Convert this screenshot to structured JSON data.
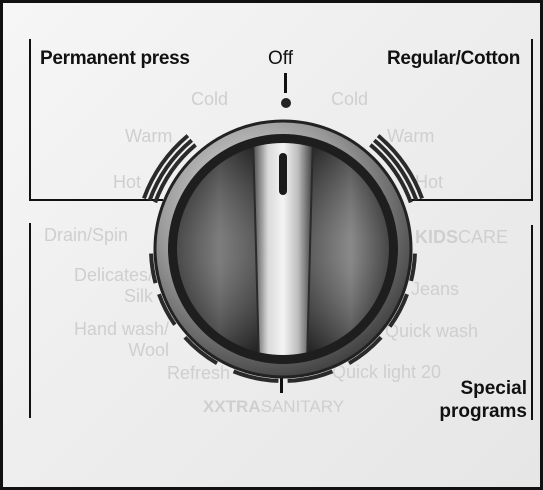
{
  "panel": {
    "permanent_press": "Permanent press",
    "off": "Off",
    "regular_cotton": "Regular/Cotton",
    "special_line1": "Special",
    "special_line2": "programs"
  },
  "left_temps": [
    "Cold",
    "Warm",
    "Hot"
  ],
  "right_temps": [
    "Cold",
    "Warm",
    "Hot"
  ],
  "left_programs": {
    "drain_spin": "Drain/Spin",
    "delicates_line1": "Delicates/",
    "delicates_line2": "Silk",
    "handwash_line1": "Hand wash/",
    "handwash_line2": "Wool",
    "refresh": "Refresh"
  },
  "right_programs": {
    "kids_bold": "KIDS",
    "kids_rest": "CARE",
    "jeans": "Jeans",
    "quick_wash": "Quick wash",
    "quick_light": "Quick light 20"
  },
  "bottom_program": {
    "xxtra_bold": "XXTRA",
    "sanitary_rest": "SANITARY"
  },
  "dial": {
    "type": "cycle selector knob",
    "selected": "Off"
  },
  "icons": [
    "off-indicator-dot-icon",
    "knob-pointer-icon"
  ]
}
